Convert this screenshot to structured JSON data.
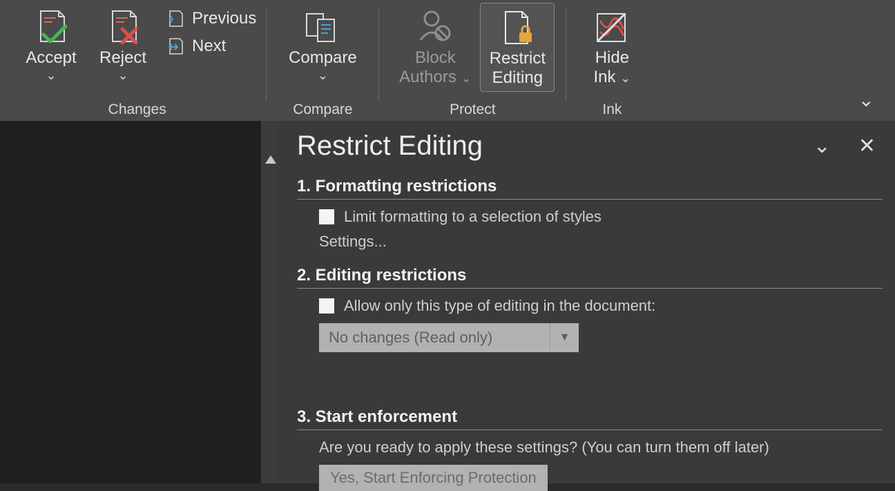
{
  "ribbon": {
    "changes": {
      "accept": "Accept",
      "reject": "Reject",
      "previous": "Previous",
      "next": "Next",
      "group": "Changes"
    },
    "compare": {
      "compare": "Compare",
      "group": "Compare"
    },
    "protect": {
      "block_authors_l1": "Block",
      "block_authors_l2": "Authors",
      "restrict_l1": "Restrict",
      "restrict_l2": "Editing",
      "group": "Protect"
    },
    "ink": {
      "hide_l1": "Hide",
      "hide_l2": "Ink",
      "group": "Ink"
    }
  },
  "panel": {
    "title": "Restrict Editing",
    "s1_head": "1. Formatting restrictions",
    "s1_check": "Limit formatting to a selection of styles",
    "s1_link": "Settings...",
    "s2_head": "2. Editing restrictions",
    "s2_check": "Allow only this type of editing in the document:",
    "s2_dd": "No changes (Read only)",
    "s3_head": "3. Start enforcement",
    "s3_prompt": "Are you ready to apply these settings? (You can turn them off later)",
    "s3_btn": "Yes, Start Enforcing Protection"
  }
}
